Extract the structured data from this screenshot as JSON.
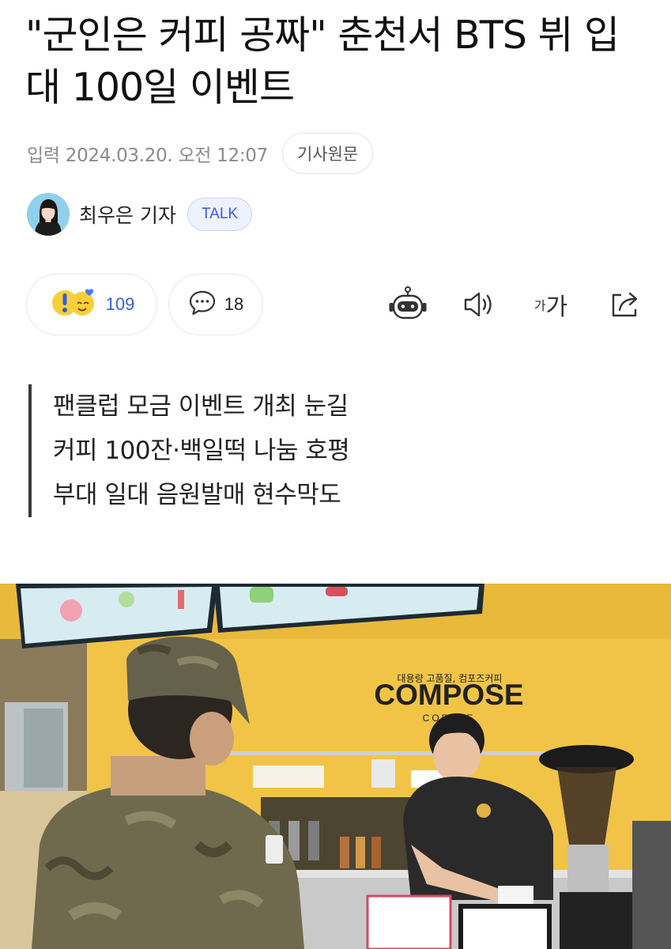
{
  "article": {
    "title": "\"군인은 커피 공짜\" 춘천서 BTS 뷔 입대 100일 이벤트",
    "date": "입력 2024.03.20. 오전 12:07",
    "original_label": "기사원문",
    "reporter": "최우은 기자",
    "talk_label": "TALK"
  },
  "actions": {
    "reaction_count": "109",
    "comment_count": "18",
    "font_small": "가",
    "font_big": "가"
  },
  "summary": [
    "팬클럽 모금 이벤트 개최 눈길",
    "커피 100잔·백일떡 나눔 호평",
    "부대 일대 음원발매 현수막도"
  ],
  "photo": {
    "sign_small": "대용량 고품질, 컴포즈커피",
    "sign_brand": "COMPOSE",
    "sign_sub": "COFFEE"
  },
  "colors": {
    "accent_blue": "#3b5bdb",
    "wall_yellow": "#f2c64a"
  },
  "icons": [
    "reaction-emoji-icon",
    "comment-icon",
    "ai-bot-icon",
    "speaker-icon",
    "share-icon"
  ]
}
